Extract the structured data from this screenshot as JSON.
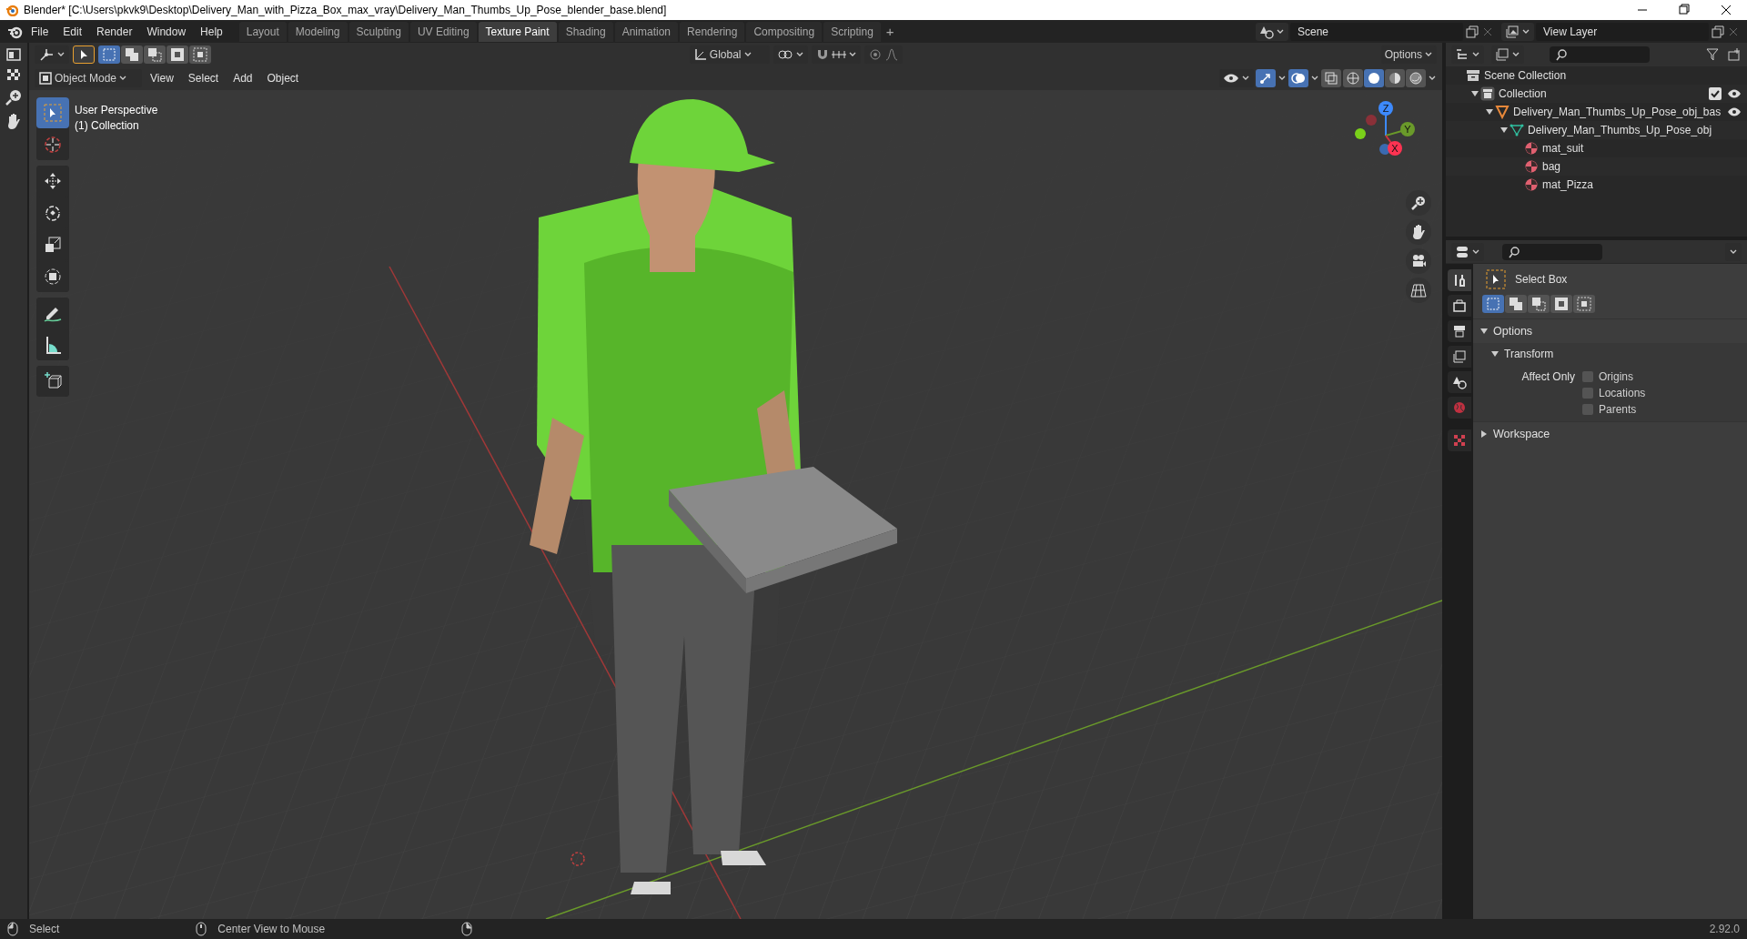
{
  "window": {
    "title": "Blender* [C:\\Users\\pkvk9\\Desktop\\Delivery_Man_with_Pizza_Box_max_vray\\Delivery_Man_Thumbs_Up_Pose_blender_base.blend]"
  },
  "menu": [
    "File",
    "Edit",
    "Render",
    "Window",
    "Help"
  ],
  "workspace_tabs": [
    {
      "label": "Layout",
      "selected": false
    },
    {
      "label": "Modeling",
      "selected": false
    },
    {
      "label": "Sculpting",
      "selected": false
    },
    {
      "label": "UV Editing",
      "selected": false
    },
    {
      "label": "Texture Paint",
      "selected": true
    },
    {
      "label": "Shading",
      "selected": false
    },
    {
      "label": "Animation",
      "selected": false
    },
    {
      "label": "Rendering",
      "selected": false
    },
    {
      "label": "Compositing",
      "selected": false
    },
    {
      "label": "Scripting",
      "selected": false
    }
  ],
  "add_workspace": "+",
  "scene": "Scene",
  "view_layer": "View Layer",
  "tool_header": {
    "select_modes": [
      {
        "selected": true
      },
      {
        "selected": false
      },
      {
        "selected": false
      },
      {
        "selected": false
      },
      {
        "selected": false
      }
    ],
    "orientation": "Global",
    "options": "Options"
  },
  "viewport_header": {
    "mode": "Object Mode",
    "menus": [
      "View",
      "Select",
      "Add",
      "Object"
    ],
    "gizmos_on": true,
    "overlays_on": true,
    "shading": [
      {
        "selected": false
      },
      {
        "selected": true
      },
      {
        "selected": false
      },
      {
        "selected": false
      }
    ]
  },
  "viewport": {
    "kind": "picture",
    "perspective": "User Perspective",
    "collection": "(1) Collection",
    "axes": [
      "Z",
      "Y",
      "X"
    ]
  },
  "tool_groups": [
    {
      "tools": [
        {
          "kind": "select",
          "selected": true
        },
        {
          "kind": "cursor",
          "selected": false
        }
      ]
    },
    {
      "tools": [
        {
          "kind": "move",
          "selected": false
        },
        {
          "kind": "rotate",
          "selected": false
        },
        {
          "kind": "scale",
          "selected": false
        },
        {
          "kind": "transform",
          "selected": false
        }
      ]
    },
    {
      "tools": [
        {
          "kind": "annotate",
          "selected": false
        },
        {
          "kind": "measure",
          "selected": false
        }
      ]
    },
    {
      "tools": [
        {
          "kind": "add_cube",
          "selected": false
        }
      ]
    }
  ],
  "outliner": {
    "items": [
      {
        "label": "Scene Collection",
        "kind": "scene",
        "children": [
          {
            "label": "Collection",
            "kind": "collection",
            "expanded": true,
            "checked": true,
            "visible": true,
            "children": [
              {
                "label": "Delivery_Man_Thumbs_Up_Pose_obj_bas",
                "kind": "empty",
                "expanded": true,
                "visible": true,
                "children": [
                  {
                    "label": "Delivery_Man_Thumbs_Up_Pose_obj",
                    "kind": "mesh",
                    "expanded": true,
                    "children": [
                      {
                        "label": "mat_suit",
                        "kind": "material"
                      },
                      {
                        "label": "bag",
                        "kind": "material"
                      },
                      {
                        "label": "mat_Pizza",
                        "kind": "material"
                      }
                    ]
                  }
                ]
              }
            ]
          }
        ]
      }
    ]
  },
  "property_tabs": [
    {
      "kind": "tool",
      "selected": true
    },
    {
      "kind": "render",
      "selected": false
    },
    {
      "kind": "output",
      "selected": false
    },
    {
      "kind": "view_layer",
      "selected": false
    },
    {
      "kind": "scene",
      "selected": false
    },
    {
      "kind": "world",
      "selected": false
    },
    {
      "kind": "texture",
      "selected": false
    }
  ],
  "properties": {
    "tool": "Select Box",
    "select_modes": [
      {
        "selected": true
      },
      {
        "selected": false
      },
      {
        "selected": false
      },
      {
        "selected": false
      },
      {
        "selected": false
      }
    ],
    "panels": [
      {
        "label": "Options",
        "expanded": true,
        "subpanels": [
          {
            "label": "Transform",
            "expanded": true,
            "field_label": "Affect Only",
            "checkboxes": [
              {
                "label": "Origins",
                "checked": false
              },
              {
                "label": "Locations",
                "checked": false
              },
              {
                "label": "Parents",
                "checked": false
              }
            ]
          }
        ]
      },
      {
        "label": "Workspace",
        "expanded": false
      }
    ]
  },
  "status_bar": {
    "hints": [
      "Select",
      "Center View to Mouse"
    ],
    "version": "2.92.0"
  }
}
